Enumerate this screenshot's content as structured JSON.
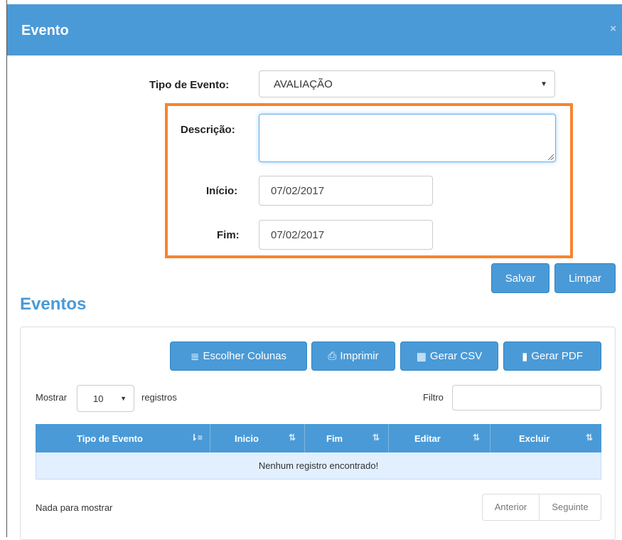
{
  "modal": {
    "title": "Evento",
    "close_icon": "close-icon",
    "close_glyph": "×"
  },
  "form": {
    "tipo_label": "Tipo de Evento:",
    "tipo_value": "AVALIAÇÃO",
    "descricao_label": "Descrição:",
    "descricao_value": "",
    "inicio_label": "Início:",
    "inicio_value": "07/02/2017",
    "fim_label": "Fim:",
    "fim_value": "07/02/2017",
    "highlight_color": "#f7842e"
  },
  "actions": {
    "save_label": "Salvar",
    "clear_label": "Limpar"
  },
  "eventos": {
    "section_title": "Eventos",
    "toolbar": [
      {
        "label": "Escolher Colunas",
        "icon": "list-icon",
        "glyph": "≣"
      },
      {
        "label": "Imprimir",
        "icon": "print-icon",
        "glyph": "⎙"
      },
      {
        "label": "Gerar CSV",
        "icon": "grid-icon",
        "glyph": "▦"
      },
      {
        "label": "Gerar PDF",
        "icon": "file-icon",
        "glyph": "▮"
      }
    ],
    "length_prefix": "Mostrar",
    "length_value": "10",
    "length_suffix": "registros",
    "filter_label": "Filtro",
    "filter_value": "",
    "columns": [
      "Tipo de Evento",
      "Inicio",
      "Fim",
      "Editar",
      "Excluir"
    ],
    "empty_message": "Nenhum registro encontrado!",
    "info": "Nada para mostrar",
    "prev_label": "Anterior",
    "next_label": "Seguinte"
  },
  "colors": {
    "primary": "#4a9ad7",
    "empty_row": "#e2efff"
  }
}
